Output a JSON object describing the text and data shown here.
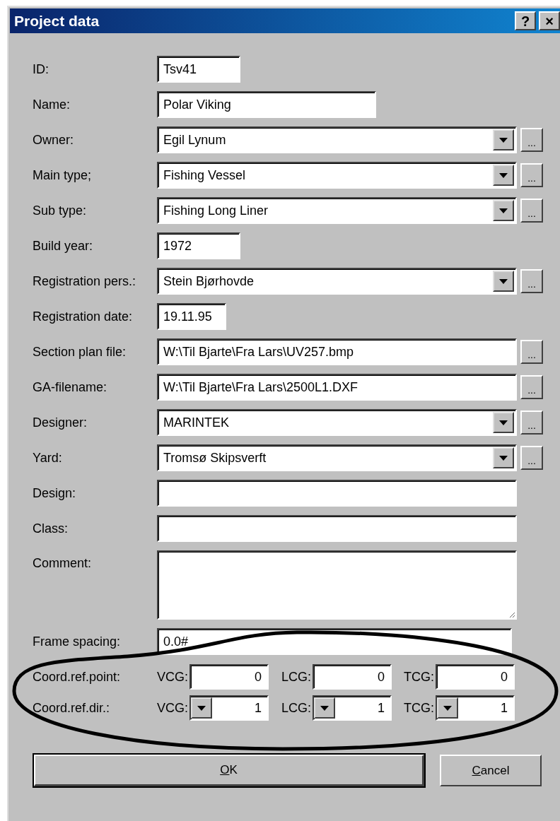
{
  "window": {
    "title": "Project data",
    "title_buttons": [
      "?",
      "×"
    ]
  },
  "fields": [
    {
      "label": "ID:",
      "kind": "text",
      "value": "Tsv41"
    },
    {
      "label": "Name:",
      "kind": "text",
      "value": "Polar Viking"
    },
    {
      "label": "Owner:",
      "kind": "combo",
      "value": "Egil Lynum",
      "browse": "..."
    },
    {
      "label": "Main type;",
      "kind": "combo",
      "value": "Fishing Vessel",
      "browse": "..."
    },
    {
      "label": "Sub type:",
      "kind": "combo",
      "value": "Fishing Long Liner",
      "browse": "..."
    },
    {
      "label": "Build year:",
      "kind": "text",
      "value": "1972"
    },
    {
      "label": "Registration pers.:",
      "kind": "combo",
      "value": "Stein Bjørhovde",
      "browse": "..."
    },
    {
      "label": "Registration date:",
      "kind": "text",
      "value": "19.11.95"
    },
    {
      "label": "Section plan file:",
      "kind": "text",
      "value": "W:\\Til Bjarte\\Fra Lars\\UV257.bmp",
      "browse": "..."
    },
    {
      "label": "GA-filename:",
      "kind": "text",
      "value": "W:\\Til Bjarte\\Fra Lars\\2500L1.DXF",
      "browse": "..."
    },
    {
      "label": "Designer:",
      "kind": "combo",
      "value": "MARINTEK",
      "browse": "..."
    },
    {
      "label": "Yard:",
      "kind": "combo",
      "value": "Tromsø Skipsverft",
      "browse": "..."
    },
    {
      "label": "Design:",
      "kind": "text"
    },
    {
      "label": "Class:",
      "kind": "text"
    },
    {
      "label": "Comment:",
      "kind": "memo"
    },
    {
      "label": "Frame spacing:",
      "kind": "text",
      "value": "0.0#"
    }
  ],
  "coord_rows": [
    {
      "label": "Coord.ref.point:",
      "kind": "value",
      "items": [
        {
          "label": "VCG:",
          "value": "0"
        },
        {
          "label": "LCG:",
          "value": "0"
        },
        {
          "label": "TCG:",
          "value": "0"
        }
      ]
    },
    {
      "label": "Coord.ref.dir.:",
      "kind": "dropdown",
      "items": [
        {
          "label": "VCG:",
          "value": "1"
        },
        {
          "label": "LCG:",
          "value": "1"
        },
        {
          "label": "TCG:",
          "value": "1"
        }
      ]
    }
  ],
  "buttons": [
    {
      "label": "OK",
      "default": true,
      "underline_first": true
    },
    {
      "label": "Cancel",
      "default": false,
      "underline_first": true
    }
  ]
}
